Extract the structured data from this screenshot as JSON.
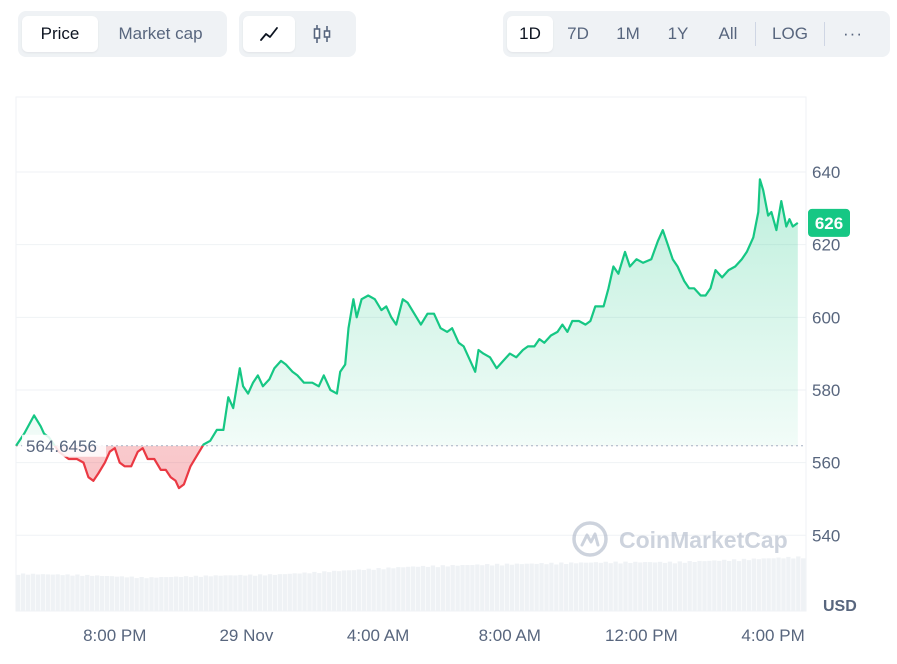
{
  "toolbar": {
    "metric_tabs": [
      {
        "label": "Price",
        "active": true
      },
      {
        "label": "Market cap",
        "active": false
      }
    ],
    "chart_type_buttons": [
      {
        "icon": "line-chart-icon",
        "active": true
      },
      {
        "icon": "candlestick-icon",
        "active": false
      }
    ],
    "range_tabs": [
      {
        "label": "1D",
        "active": true
      },
      {
        "label": "7D",
        "active": false
      },
      {
        "label": "1M",
        "active": false
      },
      {
        "label": "1Y",
        "active": false
      },
      {
        "label": "All",
        "active": false
      }
    ],
    "log_label": "LOG",
    "more_label": "···"
  },
  "watermark": "CoinMarketCap",
  "colors": {
    "up": "#16c784",
    "down": "#ea3943",
    "grid": "#eff2f5",
    "axis_text": "#58667e",
    "volume": "#eff2f5"
  },
  "chart_data": {
    "type": "line",
    "currency_label": "USD",
    "baseline": 564.6456,
    "baseline_label": "564.6456",
    "current_price_label": "626",
    "ylim": [
      526,
      660
    ],
    "yticks": [
      540,
      560,
      580,
      600,
      620,
      640
    ],
    "xlim": [
      0,
      24
    ],
    "xticks": [
      {
        "x": 3.0,
        "label": "8:00 PM"
      },
      {
        "x": 7.0,
        "label": "29 Nov"
      },
      {
        "x": 11.0,
        "label": "4:00 AM"
      },
      {
        "x": 15.0,
        "label": "8:00 AM"
      },
      {
        "x": 19.0,
        "label": "12:00 PM"
      },
      {
        "x": 23.0,
        "label": "4:00 PM"
      }
    ],
    "price": [
      [
        0.0,
        564.6
      ],
      [
        0.25,
        568
      ],
      [
        0.55,
        573
      ],
      [
        0.75,
        570
      ],
      [
        0.85,
        568
      ],
      [
        1.0,
        567
      ],
      [
        1.3,
        563
      ],
      [
        1.6,
        561
      ],
      [
        1.85,
        561
      ],
      [
        2.05,
        560
      ],
      [
        2.2,
        556
      ],
      [
        2.35,
        555
      ],
      [
        2.5,
        557
      ],
      [
        2.7,
        560
      ],
      [
        2.85,
        563
      ],
      [
        3.0,
        564
      ],
      [
        3.15,
        560
      ],
      [
        3.3,
        559
      ],
      [
        3.5,
        559
      ],
      [
        3.7,
        563
      ],
      [
        3.85,
        564
      ],
      [
        4.0,
        561
      ],
      [
        4.2,
        561
      ],
      [
        4.4,
        558
      ],
      [
        4.55,
        558
      ],
      [
        4.7,
        556
      ],
      [
        4.85,
        555
      ],
      [
        4.95,
        553
      ],
      [
        5.1,
        554
      ],
      [
        5.3,
        559
      ],
      [
        5.5,
        562
      ],
      [
        5.7,
        565
      ],
      [
        5.9,
        566
      ],
      [
        6.1,
        569
      ],
      [
        6.3,
        569
      ],
      [
        6.45,
        578
      ],
      [
        6.6,
        575
      ],
      [
        6.8,
        586
      ],
      [
        6.9,
        581
      ],
      [
        7.05,
        579
      ],
      [
        7.2,
        582
      ],
      [
        7.35,
        584
      ],
      [
        7.5,
        581
      ],
      [
        7.7,
        583
      ],
      [
        7.85,
        586
      ],
      [
        8.05,
        588
      ],
      [
        8.2,
        587
      ],
      [
        8.4,
        585
      ],
      [
        8.55,
        584
      ],
      [
        8.75,
        582
      ],
      [
        9.0,
        582
      ],
      [
        9.2,
        581
      ],
      [
        9.35,
        584
      ],
      [
        9.55,
        580
      ],
      [
        9.75,
        579
      ],
      [
        9.85,
        585
      ],
      [
        10.0,
        587
      ],
      [
        10.1,
        597
      ],
      [
        10.25,
        605
      ],
      [
        10.35,
        600
      ],
      [
        10.5,
        605
      ],
      [
        10.7,
        606
      ],
      [
        10.9,
        605
      ],
      [
        11.1,
        602
      ],
      [
        11.25,
        603
      ],
      [
        11.4,
        600
      ],
      [
        11.55,
        598
      ],
      [
        11.75,
        605
      ],
      [
        11.9,
        604
      ],
      [
        12.1,
        601
      ],
      [
        12.3,
        598
      ],
      [
        12.5,
        601
      ],
      [
        12.7,
        601
      ],
      [
        12.9,
        597
      ],
      [
        13.1,
        596
      ],
      [
        13.25,
        597
      ],
      [
        13.45,
        593
      ],
      [
        13.6,
        592
      ],
      [
        13.8,
        588
      ],
      [
        13.95,
        585
      ],
      [
        14.05,
        591
      ],
      [
        14.2,
        590
      ],
      [
        14.4,
        589
      ],
      [
        14.6,
        586
      ],
      [
        14.8,
        588
      ],
      [
        15.0,
        590
      ],
      [
        15.2,
        589
      ],
      [
        15.4,
        591
      ],
      [
        15.55,
        592
      ],
      [
        15.75,
        592
      ],
      [
        15.9,
        594
      ],
      [
        16.05,
        593
      ],
      [
        16.25,
        595
      ],
      [
        16.45,
        596
      ],
      [
        16.6,
        598
      ],
      [
        16.75,
        596
      ],
      [
        16.9,
        599
      ],
      [
        17.1,
        599
      ],
      [
        17.3,
        598
      ],
      [
        17.45,
        599
      ],
      [
        17.6,
        603
      ],
      [
        17.85,
        603
      ],
      [
        18.0,
        608
      ],
      [
        18.15,
        614
      ],
      [
        18.3,
        612
      ],
      [
        18.5,
        618
      ],
      [
        18.65,
        614
      ],
      [
        18.85,
        616
      ],
      [
        19.05,
        615
      ],
      [
        19.3,
        616
      ],
      [
        19.5,
        621
      ],
      [
        19.65,
        624
      ],
      [
        19.8,
        620
      ],
      [
        19.95,
        616
      ],
      [
        20.1,
        614
      ],
      [
        20.3,
        610
      ],
      [
        20.45,
        608
      ],
      [
        20.6,
        608
      ],
      [
        20.8,
        606
      ],
      [
        20.95,
        606
      ],
      [
        21.1,
        608
      ],
      [
        21.25,
        613
      ],
      [
        21.45,
        611
      ],
      [
        21.65,
        613
      ],
      [
        21.85,
        614
      ],
      [
        22.05,
        616
      ],
      [
        22.2,
        618
      ],
      [
        22.4,
        622
      ],
      [
        22.55,
        629
      ],
      [
        22.6,
        638
      ],
      [
        22.7,
        635
      ],
      [
        22.85,
        628
      ],
      [
        22.95,
        629
      ],
      [
        23.1,
        624
      ],
      [
        23.25,
        632
      ],
      [
        23.4,
        625
      ],
      [
        23.5,
        627
      ],
      [
        23.6,
        625
      ],
      [
        23.75,
        626
      ]
    ],
    "volume": [
      [
        0.0,
        0.58
      ],
      [
        2.0,
        0.56
      ],
      [
        4.0,
        0.52
      ],
      [
        6.0,
        0.55
      ],
      [
        8.0,
        0.57
      ],
      [
        10.0,
        0.63
      ],
      [
        12.0,
        0.69
      ],
      [
        14.0,
        0.72
      ],
      [
        16.0,
        0.74
      ],
      [
        18.0,
        0.76
      ],
      [
        20.0,
        0.76
      ],
      [
        22.0,
        0.8
      ],
      [
        23.75,
        0.84
      ]
    ]
  }
}
